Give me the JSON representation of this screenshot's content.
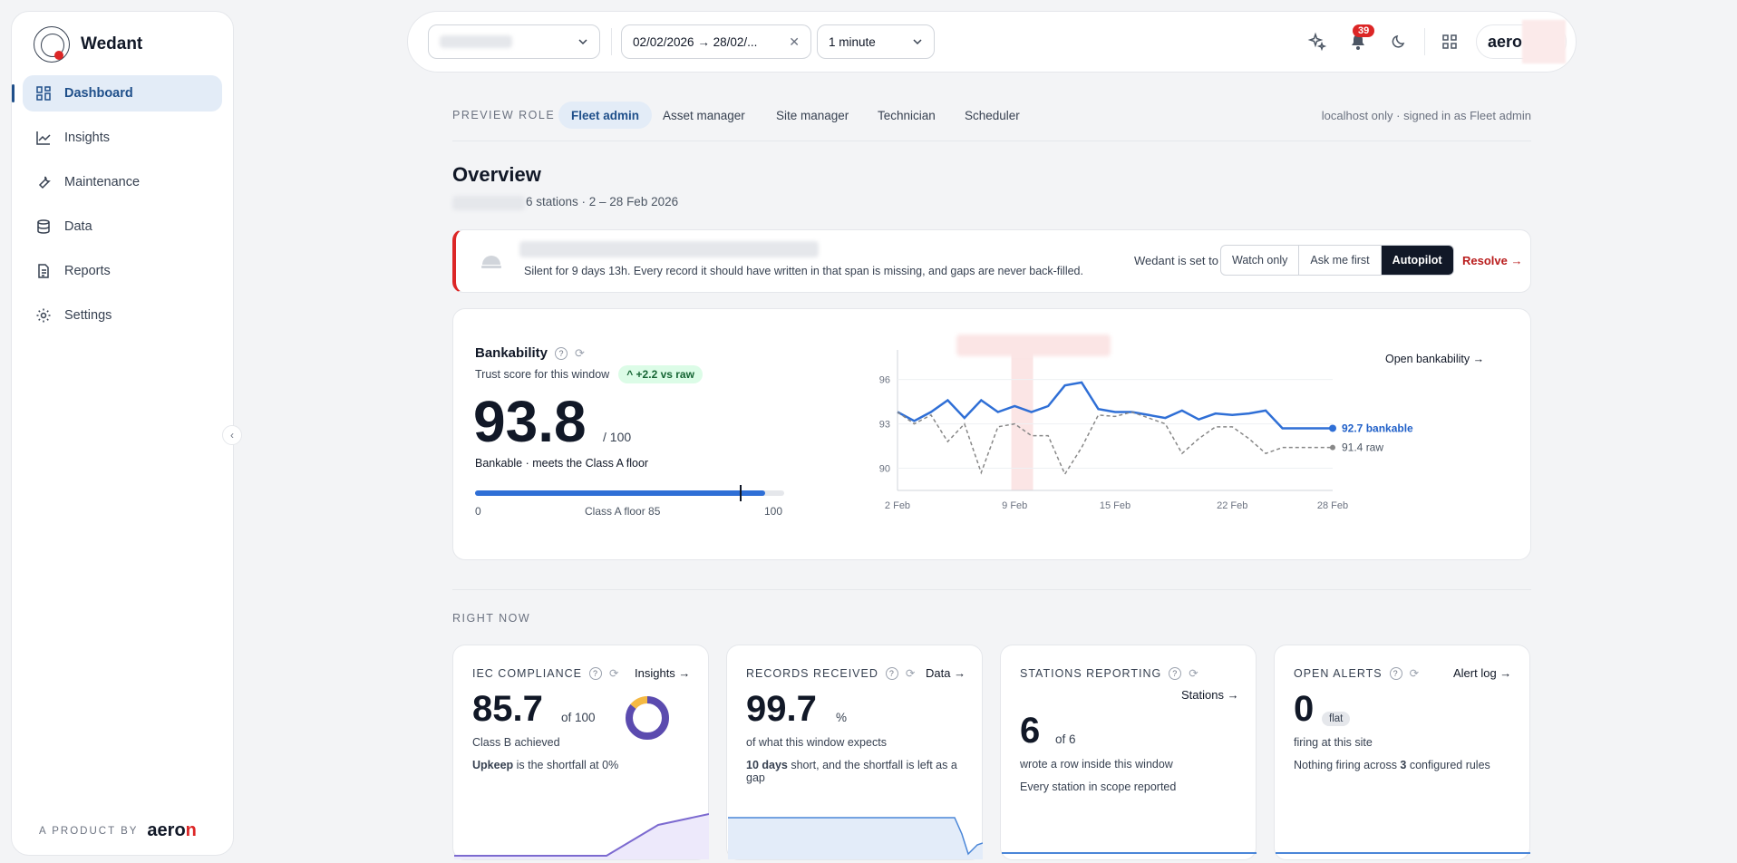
{
  "sidebar": {
    "brand": "Wedant",
    "items": [
      {
        "label": "Dashboard"
      },
      {
        "label": "Insights"
      },
      {
        "label": "Maintenance"
      },
      {
        "label": "Data"
      },
      {
        "label": "Reports"
      },
      {
        "label": "Settings"
      }
    ],
    "footer_prefix": "A PRODUCT BY",
    "footer_brand_a": "aero",
    "footer_brand_b": "n"
  },
  "topbar": {
    "date_range": "02/02/2026 → 28/02/...",
    "interval": "1 minute",
    "notification_count": "39",
    "account_brand": "aero"
  },
  "roles": {
    "label": "PREVIEW ROLE",
    "tabs": [
      "Fleet admin",
      "Asset manager",
      "Site manager",
      "Technician",
      "Scheduler"
    ],
    "note": "localhost only · signed in as Fleet admin"
  },
  "overview": {
    "title": "Overview",
    "subtitle": "6 stations · 2 – 28 Feb 2026"
  },
  "alert": {
    "text": "Silent for 9 days 13h. Every record it should have written in that span is missing, and gaps are never back-filled.",
    "set_label": "Wedant is set to",
    "modes": [
      "Watch only",
      "Ask me first",
      "Autopilot"
    ],
    "active_mode": "Autopilot",
    "resolve": "Resolve →"
  },
  "bankability": {
    "title": "Bankability",
    "subtitle": "Trust score for this window",
    "delta": "+2.2 vs raw",
    "score": "93.8",
    "score_max": "/ 100",
    "status": "Bankable · meets the Class A floor",
    "progress_value": 93.8,
    "marker_value": 85,
    "scale_min": "0",
    "scale_mid": "Class A floor 85",
    "scale_max": "100",
    "open_link": "Open bankability →"
  },
  "chart_data": {
    "type": "line",
    "y_ticks": [
      "96",
      "93",
      "90"
    ],
    "ylim": [
      88.5,
      98
    ],
    "x_ticks": [
      "2 Feb",
      "9 Feb",
      "15 Feb",
      "22 Feb",
      "28 Feb"
    ],
    "x": [
      2,
      3,
      4,
      5,
      6,
      7,
      8,
      9,
      10,
      11,
      12,
      13,
      14,
      15,
      16,
      17,
      18,
      19,
      20,
      21,
      22,
      23,
      24,
      25,
      26,
      27,
      28
    ],
    "series": [
      {
        "name": "bankable",
        "end_label": "92.7 bankable",
        "color": "#2f6fd6",
        "values": [
          93.8,
          93.2,
          93.8,
          94.6,
          93.4,
          94.6,
          93.8,
          94.2,
          93.8,
          94.2,
          95.6,
          95.8,
          94.0,
          93.8,
          93.8,
          93.6,
          93.4,
          93.9,
          93.3,
          93.7,
          93.6,
          93.7,
          93.9,
          92.7,
          92.7,
          92.7,
          92.7
        ]
      },
      {
        "name": "raw",
        "end_label": "91.4 raw",
        "color": "#888888",
        "values": [
          93.8,
          93.0,
          93.6,
          91.8,
          93.0,
          89.7,
          92.8,
          93.0,
          92.2,
          92.2,
          89.6,
          91.4,
          93.6,
          93.5,
          93.8,
          93.4,
          93.0,
          91.0,
          92.0,
          92.8,
          92.8,
          92.0,
          91.0,
          91.4,
          91.4,
          91.4,
          91.4
        ]
      }
    ],
    "highlight_range": [
      8.8,
      10.1
    ]
  },
  "right_now": {
    "label": "RIGHT NOW",
    "cards": [
      {
        "title": "IEC COMPLIANCE",
        "link": "Insights →",
        "value": "85.7",
        "unit": "of 100",
        "sub": "Class B achieved",
        "note_bold": "Upkeep",
        "note": " is the shortfall at 0%",
        "donut_fraction": 0.857
      },
      {
        "title": "RECORDS RECEIVED",
        "link": "Data →",
        "value": "99.7",
        "unit": "%",
        "sub": "of what this window expects",
        "note_bold": "10 days",
        "note": " short, and the shortfall is left as a gap"
      },
      {
        "title": "STATIONS REPORTING",
        "link": "Stations →",
        "value": "6",
        "unit": "of 6",
        "sub": "wrote a row inside this window",
        "note": "Every station in scope reported"
      },
      {
        "title": "OPEN ALERTS",
        "link": "Alert log →",
        "value": "0",
        "unit": "flat",
        "sub": "firing at this site",
        "note_pre": "Nothing firing across ",
        "note_bold": "3",
        "note": " configured rules"
      }
    ]
  },
  "colors": {
    "accent": "#1f4f8a",
    "alert": "#dc2626",
    "line_blue": "#2f6fd6"
  }
}
